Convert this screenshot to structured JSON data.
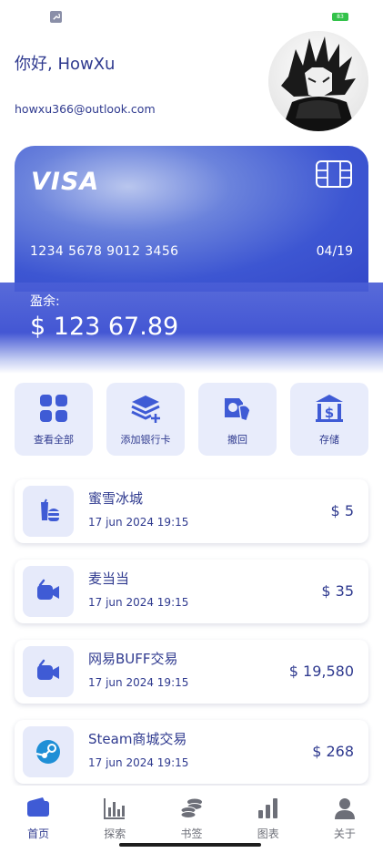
{
  "header": {
    "greeting": "你好, HowXu",
    "email": "howxu366@outlook.com"
  },
  "card": {
    "brand": "VISA",
    "number": "1234 5678 9012 3456",
    "expiry": "04/19"
  },
  "balance": {
    "label": "盈余:",
    "amount": "$ 123 67.89"
  },
  "actions": [
    {
      "label": "查看全部",
      "icon": "grid-icon"
    },
    {
      "label": "添加银行卡",
      "icon": "add-card-stack-icon"
    },
    {
      "label": "撤回",
      "icon": "withdraw-icon"
    },
    {
      "label": "存储",
      "icon": "deposit-icon"
    }
  ],
  "transactions": [
    {
      "name": "蜜雪冰城",
      "date": "17 jun 2024 19:15",
      "amount": "$ 5",
      "icon": "fast-food-icon"
    },
    {
      "name": "麦当当",
      "date": "17 jun 2024 19:15",
      "amount": "$ 35",
      "icon": "video-camera-icon"
    },
    {
      "name": "网易BUFF交易",
      "date": "17 jun 2024 19:15",
      "amount": "$ 19,580",
      "icon": "video-camera-icon"
    },
    {
      "name": "Steam商城交易",
      "date": "17 jun 2024 19:15",
      "amount": "$ 268",
      "icon": "steam-icon"
    }
  ],
  "nav": [
    {
      "label": "首页",
      "icon": "wallet-icon",
      "active": true
    },
    {
      "label": "探索",
      "icon": "bar-chart-icon"
    },
    {
      "label": "书签",
      "icon": "coins-icon"
    },
    {
      "label": "图表",
      "icon": "growth-chart-icon"
    },
    {
      "label": "关于",
      "icon": "person-icon"
    }
  ],
  "status_bar": {
    "battery": "83"
  },
  "colors": {
    "primary": "#2f3a8f",
    "card_blue": "#3d56d2",
    "tile_bg": "#e8ecfb",
    "icon_blue": "#3f5bd5"
  }
}
